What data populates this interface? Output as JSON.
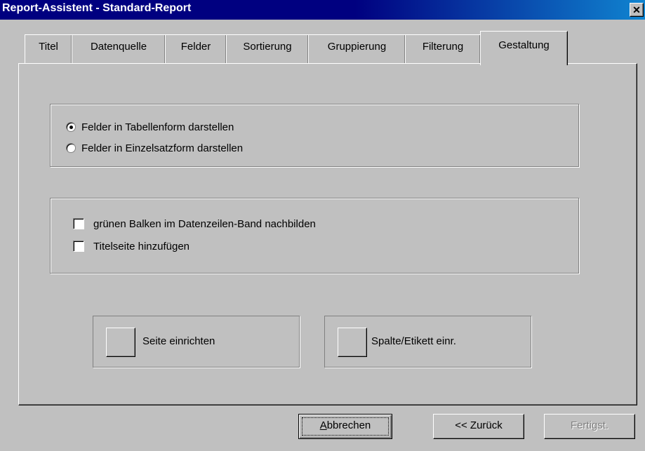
{
  "window": {
    "title": "Report-Assistent - Standard-Report",
    "close_label": "✕"
  },
  "tabs": [
    {
      "label": "Titel"
    },
    {
      "label": "Datenquelle"
    },
    {
      "label": "Felder"
    },
    {
      "label": "Sortierung"
    },
    {
      "label": "Gruppierung"
    },
    {
      "label": "Filterung"
    },
    {
      "label": "Gestaltung",
      "active": true
    }
  ],
  "layout_options": {
    "radios": [
      {
        "label": "Felder in Tabellenform darstellen",
        "checked": true
      },
      {
        "label": "Felder in Einzelsatzform darstellen",
        "checked": false
      }
    ]
  },
  "extras": {
    "checkboxes": [
      {
        "label": "grünen Balken im Datenzeilen-Band nachbilden",
        "checked": false
      },
      {
        "label": "Titelseite hinzufügen",
        "checked": false
      }
    ]
  },
  "setup_buttons": {
    "page_setup": "Seite einrichten",
    "column_label_setup": "Spalte/Etikett einr."
  },
  "footer": {
    "cancel_accel": "A",
    "cancel_rest": "bbrechen",
    "back": "<< Zurück",
    "finish": "Fertigst."
  }
}
